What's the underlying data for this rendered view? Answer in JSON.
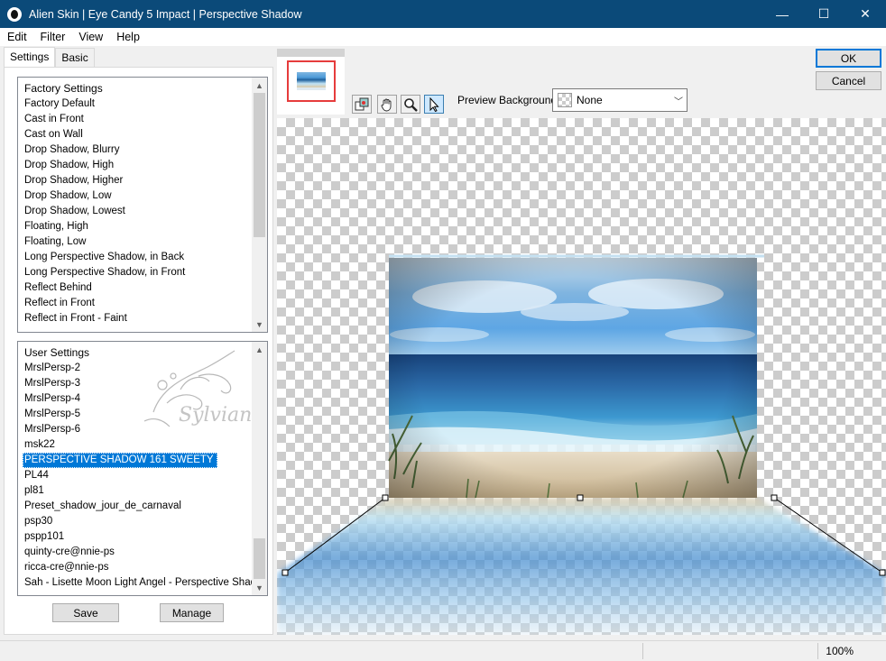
{
  "window": {
    "title": "Alien Skin | Eye Candy 5 Impact | Perspective Shadow",
    "minimize": "—",
    "maximize": "☐",
    "close": "✕"
  },
  "menu": [
    {
      "label": "Edit"
    },
    {
      "label": "Filter"
    },
    {
      "label": "View"
    },
    {
      "label": "Help"
    }
  ],
  "tabs": [
    {
      "label": "Settings",
      "active": true
    },
    {
      "label": "Basic",
      "active": false
    }
  ],
  "factory_settings": {
    "header": "Factory Settings",
    "items": [
      "Factory Default",
      "Cast in Front",
      "Cast on Wall",
      "Drop Shadow, Blurry",
      "Drop Shadow, High",
      "Drop Shadow, Higher",
      "Drop Shadow, Low",
      "Drop Shadow, Lowest",
      "Floating, High",
      "Floating, Low",
      "Long Perspective Shadow, in Back",
      "Long Perspective Shadow, in Front",
      "Reflect Behind",
      "Reflect in Front",
      "Reflect in Front - Faint"
    ]
  },
  "user_settings": {
    "header": "User Settings",
    "items": [
      "MrslPersp-2",
      "MrslPersp-3",
      "MrslPersp-4",
      "MrslPersp-5",
      "MrslPersp-6",
      "msk22",
      "PERSPECTIVE SHADOW 161 SWEETY",
      "PL44",
      "pl81",
      "Preset_shadow_jour_de_carnaval",
      "psp30",
      "pspp101",
      "quinty-cre@nnie-ps",
      "ricca-cre@nnie-ps",
      "Sah - Lisette Moon Light Angel - Perspective Shadow"
    ],
    "selected": "PERSPECTIVE SHADOW 161 SWEETY"
  },
  "watermark_text": "Sylviane",
  "buttons": {
    "save": "Save",
    "manage": "Manage",
    "ok": "OK",
    "cancel": "Cancel"
  },
  "toolbar": {
    "tools": [
      "toggle-preview-icon",
      "hand-icon",
      "zoom-icon",
      "arrow-pointer-icon"
    ],
    "active_tool": "arrow-pointer-icon"
  },
  "preview_background": {
    "label": "Preview Background:",
    "value": "None"
  },
  "status": {
    "zoom": "100%"
  },
  "colors": {
    "titlebar": "#0b4a79",
    "selection": "#0078d7",
    "thumbnail_highlight": "#e63c3c"
  }
}
